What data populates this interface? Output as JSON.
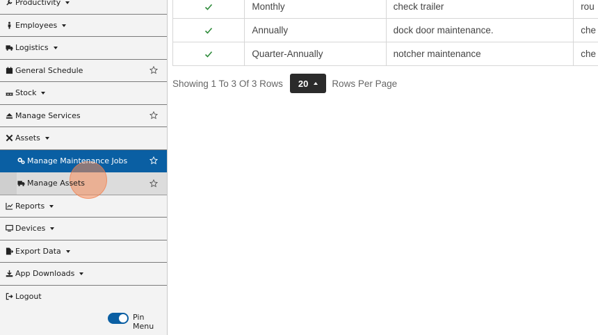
{
  "sidebar": {
    "items": [
      {
        "label": "Productivity",
        "icon": "wrench-icon",
        "caret": true
      },
      {
        "label": "Employees",
        "icon": "person-icon",
        "caret": true
      },
      {
        "label": "Logistics",
        "icon": "truck-icon",
        "caret": true
      },
      {
        "label": "General Schedule",
        "icon": "calendar-icon",
        "star": true
      },
      {
        "label": "Stock",
        "icon": "pallet-icon",
        "caret": true
      },
      {
        "label": "Manage Services",
        "icon": "eject-icon",
        "star": true
      },
      {
        "label": "Assets",
        "icon": "tools-icon",
        "caret": true
      },
      {
        "label": "Manage Maintenance Jobs",
        "icon": "cogs-icon",
        "star": true,
        "active": true
      },
      {
        "label": "Manage Assets",
        "icon": "truck-icon",
        "star": true,
        "hover": true
      },
      {
        "label": "Reports",
        "icon": "chart-icon",
        "caret": true
      },
      {
        "label": "Devices",
        "icon": "monitor-icon",
        "caret": true
      },
      {
        "label": "Export Data",
        "icon": "export-file-icon",
        "caret": true
      },
      {
        "label": "App Downloads",
        "icon": "download-icon",
        "caret": true
      },
      {
        "label": "Logout",
        "icon": "logout-icon"
      }
    ],
    "pin_label": "Pin Menu",
    "pin_enabled": true
  },
  "table": {
    "rows": [
      {
        "frequency": "Monthly",
        "description": "check trailer",
        "extra": "rou"
      },
      {
        "frequency": "Annually",
        "description": "dock door maintenance.",
        "extra": "che"
      },
      {
        "frequency": "Quarter-Annually",
        "description": "notcher maintenance",
        "extra": "che"
      }
    ]
  },
  "pager": {
    "showing_text": "Showing 1 To 3 Of 3 Rows",
    "rows_per_page": "20",
    "rows_per_page_label": "Rows Per Page"
  },
  "colors": {
    "accent": "#0a5fa3",
    "check": "#2e8b3a"
  }
}
